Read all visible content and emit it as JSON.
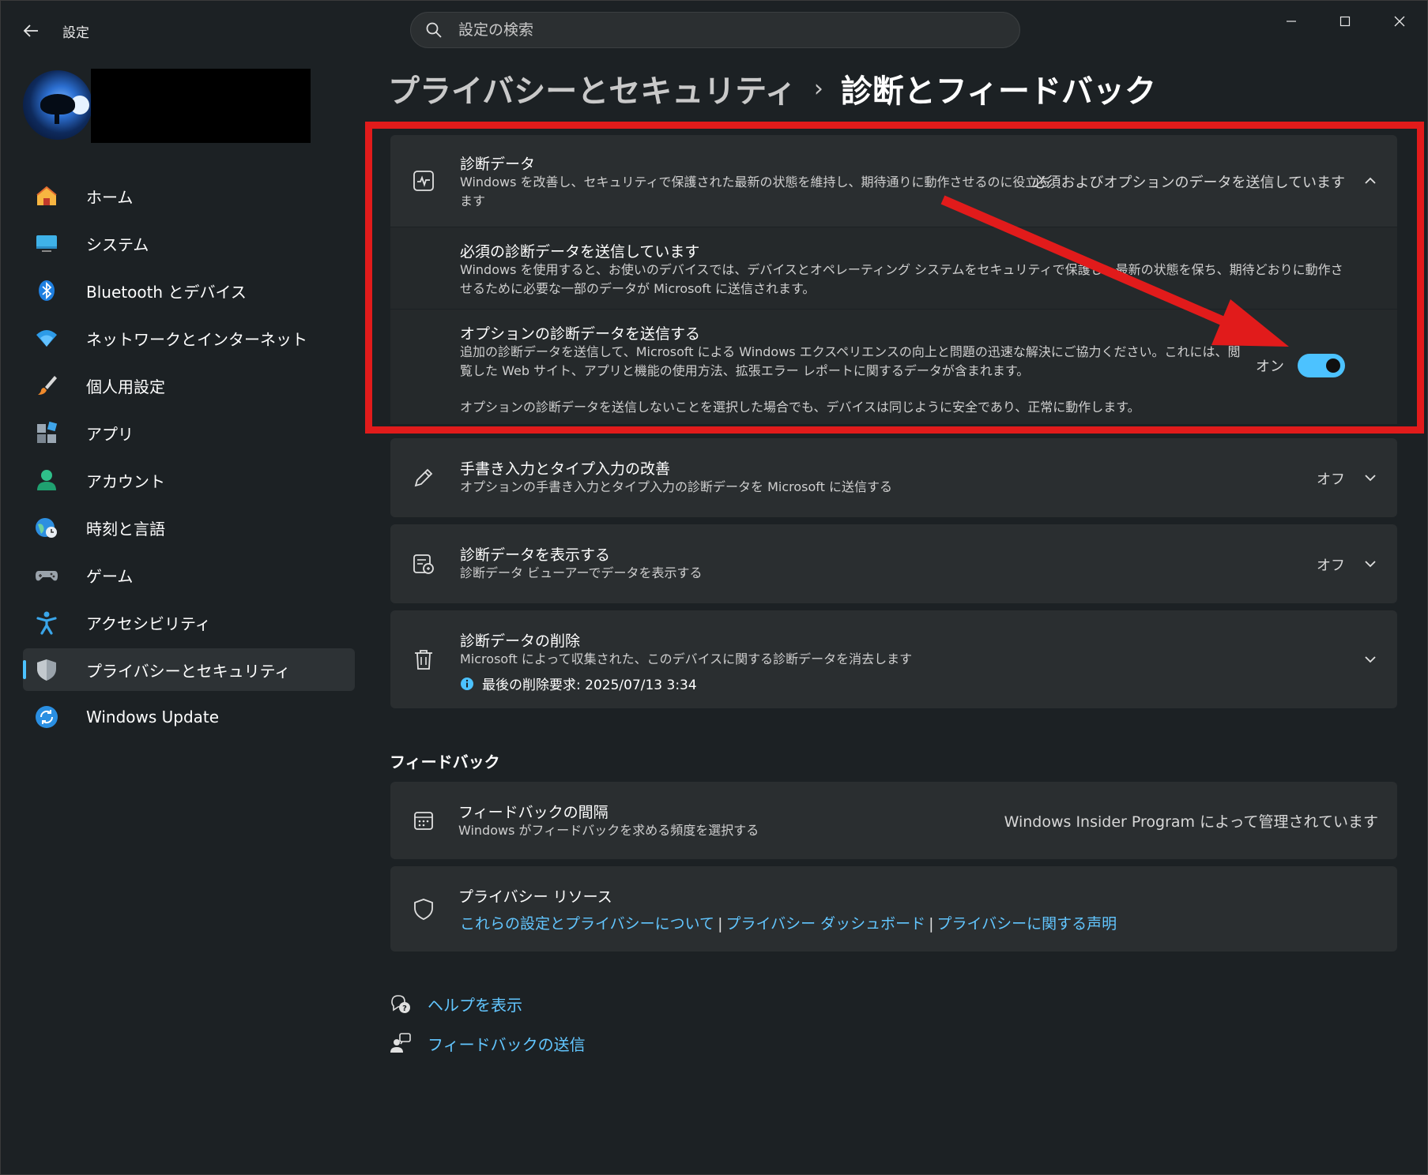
{
  "window": {
    "app_title": "設定",
    "back_label": "←"
  },
  "search": {
    "placeholder": "設定の検索"
  },
  "sidebar": {
    "items": [
      {
        "label": "ホーム"
      },
      {
        "label": "システム"
      },
      {
        "label": "Bluetooth とデバイス"
      },
      {
        "label": "ネットワークとインターネット"
      },
      {
        "label": "個人用設定"
      },
      {
        "label": "アプリ"
      },
      {
        "label": "アカウント"
      },
      {
        "label": "時刻と言語"
      },
      {
        "label": "ゲーム"
      },
      {
        "label": "アクセシビリティ"
      },
      {
        "label": "プライバシーとセキュリティ"
      },
      {
        "label": "Windows Update"
      }
    ]
  },
  "breadcrumb": {
    "parent": "プライバシーとセキュリティ",
    "separator": "›",
    "current": "診断とフィードバック"
  },
  "diag_card": {
    "title": "診断データ",
    "desc": "Windows を改善し、セキュリティで保護された最新の状態を維持し、期待通りに動作させるのに役立ちます",
    "status": "必須およびオプションのデータを送信しています",
    "required": {
      "title": "必須の診断データを送信しています",
      "desc": "Windows を使用すると、お使いのデバイスでは、デバイスとオペレーティング システムをセキュリティで保護し、最新の状態を保ち、期待どおりに動作させるために必要な一部のデータが Microsoft に送信されます。"
    },
    "optional": {
      "title": "オプションの診断データを送信する",
      "desc": "追加の診断データを送信して、Microsoft による Windows エクスペリエンスの向上と問題の迅速な解決にご協力ください。これには、閲覧した Web サイト、アプリと機能の使用方法、拡張エラー レポートに関するデータが含まれます。",
      "note": "オプションの診断データを送信しないことを選択した場合でも、デバイスは同じように安全であり、正常に動作します。",
      "toggle_label": "オン",
      "toggle_on": true
    }
  },
  "handwriting_card": {
    "title": "手書き入力とタイプ入力の改善",
    "desc": "オプションの手書き入力とタイプ入力の診断データを Microsoft に送信する",
    "status": "オフ"
  },
  "view_card": {
    "title": "診断データを表示する",
    "desc": "診断データ ビューアーでデータを表示する",
    "status": "オフ"
  },
  "delete_card": {
    "title": "診断データの削除",
    "desc": "Microsoft によって収集された、このデバイスに関する診断データを消去します",
    "last_delete": "最後の削除要求: 2025/07/13 3:34"
  },
  "feedback_section": {
    "heading": "フィードバック",
    "frequency": {
      "title": "フィードバックの間隔",
      "desc": "Windows がフィードバックを求める頻度を選択する",
      "status": "Windows Insider Program によって管理されています"
    },
    "resources": {
      "title": "プライバシー リソース",
      "links": [
        "これらの設定とプライバシーについて",
        "プライバシー ダッシュボード",
        "プライバシーに関する声明"
      ],
      "separator": "|"
    }
  },
  "footer": {
    "help": "ヘルプを表示",
    "feedback": "フィードバックの送信"
  },
  "colors": {
    "accent": "#4cc2ff",
    "link": "#62c6ff",
    "annotation_red": "#e11b1b",
    "window_bg": "#1c2124",
    "card_bg": "#2a2e30"
  }
}
